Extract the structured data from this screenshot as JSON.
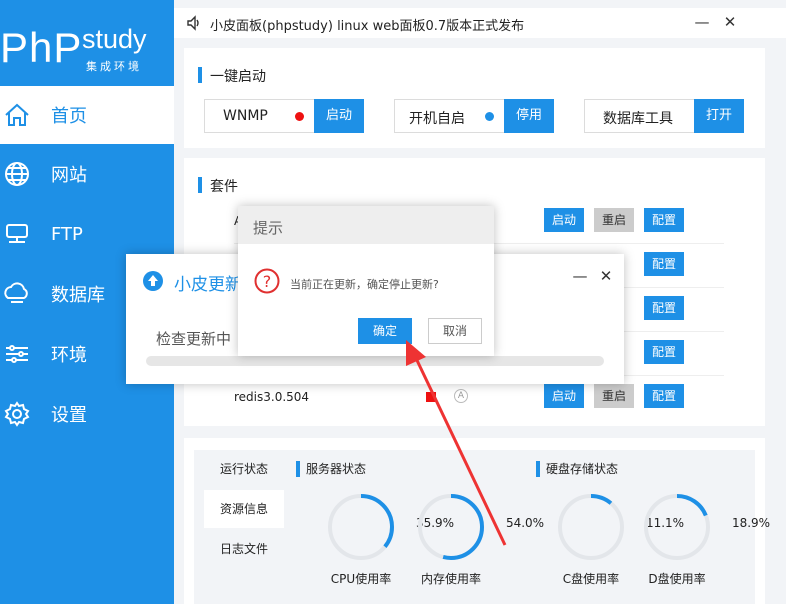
{
  "brand": {
    "logo_php": "PhP",
    "logo_study": "study",
    "logo_sub": "集成环境"
  },
  "sidebar": {
    "items": [
      {
        "label": "首页",
        "icon": "home-icon",
        "active": true
      },
      {
        "label": "网站",
        "icon": "globe-icon"
      },
      {
        "label": "FTP",
        "icon": "server-icon"
      },
      {
        "label": "数据库",
        "icon": "database-icon"
      },
      {
        "label": "环境",
        "icon": "sliders-icon"
      },
      {
        "label": "设置",
        "icon": "gear-icon"
      }
    ]
  },
  "title_bar": {
    "text": "小皮面板(phpstudy) linux web面板0.7版本正式发布",
    "minimize": "—",
    "close": "✕"
  },
  "quick_start": {
    "title": "一键启动",
    "boxes": [
      {
        "label": "WNMP",
        "button": "启动",
        "dot_color": "#ee1111"
      },
      {
        "label": "开机自启",
        "button": "停用",
        "dot_color": "#1e90e6"
      },
      {
        "label": "数据库工具",
        "button": "打开"
      }
    ]
  },
  "suite": {
    "title": "套件",
    "rows": [
      {
        "name": "A",
        "start": "启动",
        "restart": "重启",
        "config": "配置"
      },
      {
        "name": "",
        "start": "",
        "restart": "",
        "config": "配置"
      },
      {
        "name": "",
        "start": "",
        "restart": "",
        "config": "配置"
      },
      {
        "name": "",
        "start": "",
        "restart": "",
        "config": "配置"
      },
      {
        "name": "redis3.0.504",
        "start": "启动",
        "restart": "重启",
        "config": "配置"
      }
    ]
  },
  "stats": {
    "tabs": [
      "运行状态",
      "资源信息",
      "日志文件"
    ],
    "server_title": "服务器状态",
    "disk_title": "硬盘存储状态",
    "gauges": [
      {
        "label": "CPU使用率",
        "value": "35.9%",
        "fraction": 0.359
      },
      {
        "label": "内存使用率",
        "value": "54.0%",
        "fraction": 0.54
      },
      {
        "label": "C盘使用率",
        "value": "11.1%",
        "fraction": 0.111
      },
      {
        "label": "D盘使用率",
        "value": "18.9%",
        "fraction": 0.189
      }
    ]
  },
  "updater": {
    "title": "小皮更新",
    "status": "检查更新中",
    "minimize": "—",
    "close": "✕"
  },
  "confirm": {
    "title": "提示",
    "message": "当前正在更新，确定停止更新?",
    "ok": "确定",
    "cancel": "取消"
  },
  "colors": {
    "accent": "#1e90e6",
    "red": "#ee1111",
    "arrow": "#ee3333"
  }
}
